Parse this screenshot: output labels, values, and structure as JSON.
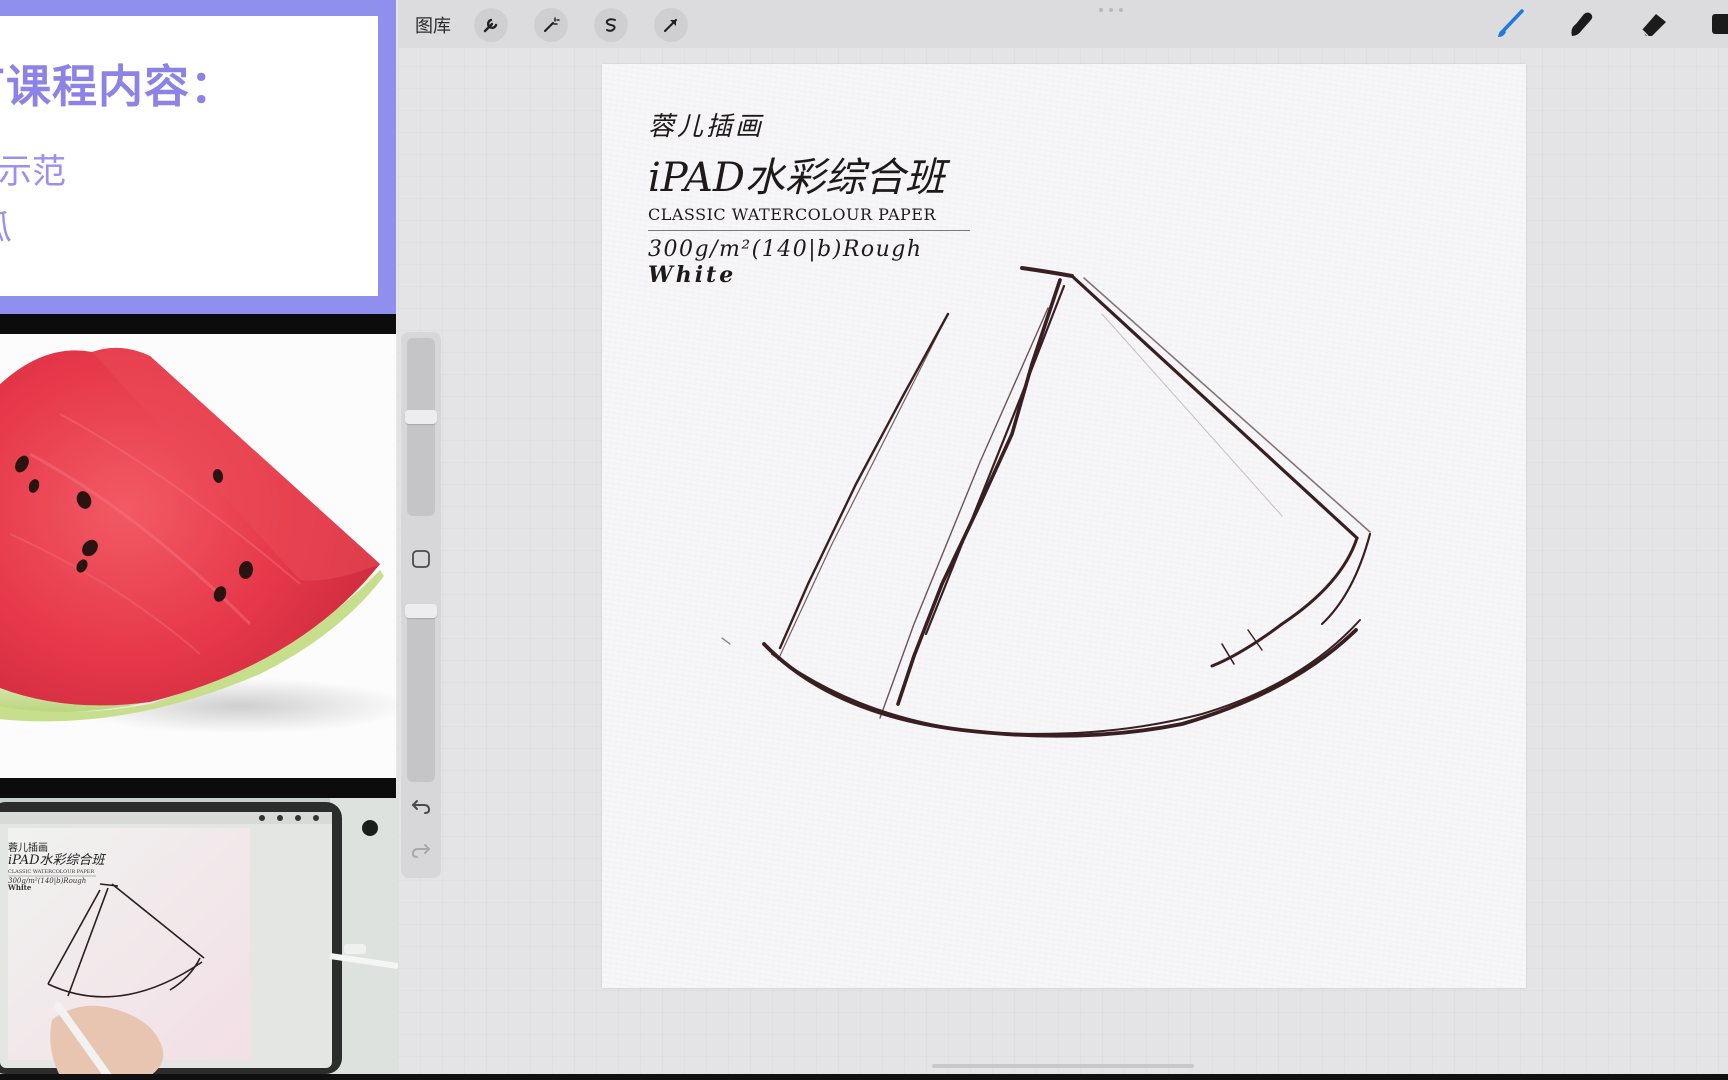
{
  "lesson_panel": {
    "title": "节课程内容：",
    "items": [
      "例示范",
      "瓜"
    ]
  },
  "reference_photo": {
    "subject": "watermelon-slice"
  },
  "toolbar": {
    "gallery_label": "图库",
    "left_tools": [
      "wrench-icon",
      "magic-wand-icon",
      "selection-icon",
      "transform-arrow-icon"
    ],
    "right_tools": [
      "brush-icon",
      "smudge-icon",
      "eraser-icon",
      "layers-icon"
    ],
    "active_tool": "brush-icon",
    "accent_color": "#1f7ae0"
  },
  "canvas": {
    "label_studio": "蓉儿插画",
    "label_course": "iPAD水彩综合班",
    "label_paper": "CLASSIC WATERCOLOUR PAPER",
    "label_spec": "300g/m²(140|b)Rough",
    "label_color": "White",
    "drawing_subject": "watermelon slice sketch"
  },
  "video_inset": {
    "label_studio": "蓉儿插画",
    "label_course": "iPAD水彩综合班",
    "label_paper": "CLASSIC WATERCOLOUR PAPER",
    "label_spec": "300g/m²(140|b)Rough",
    "label_color": "White"
  },
  "colors": {
    "lesson_frame": "#8f90ee",
    "lesson_text": "#8d82e6",
    "sketch_ink": "#3a1f22",
    "app_background": "#e4e4e6"
  }
}
